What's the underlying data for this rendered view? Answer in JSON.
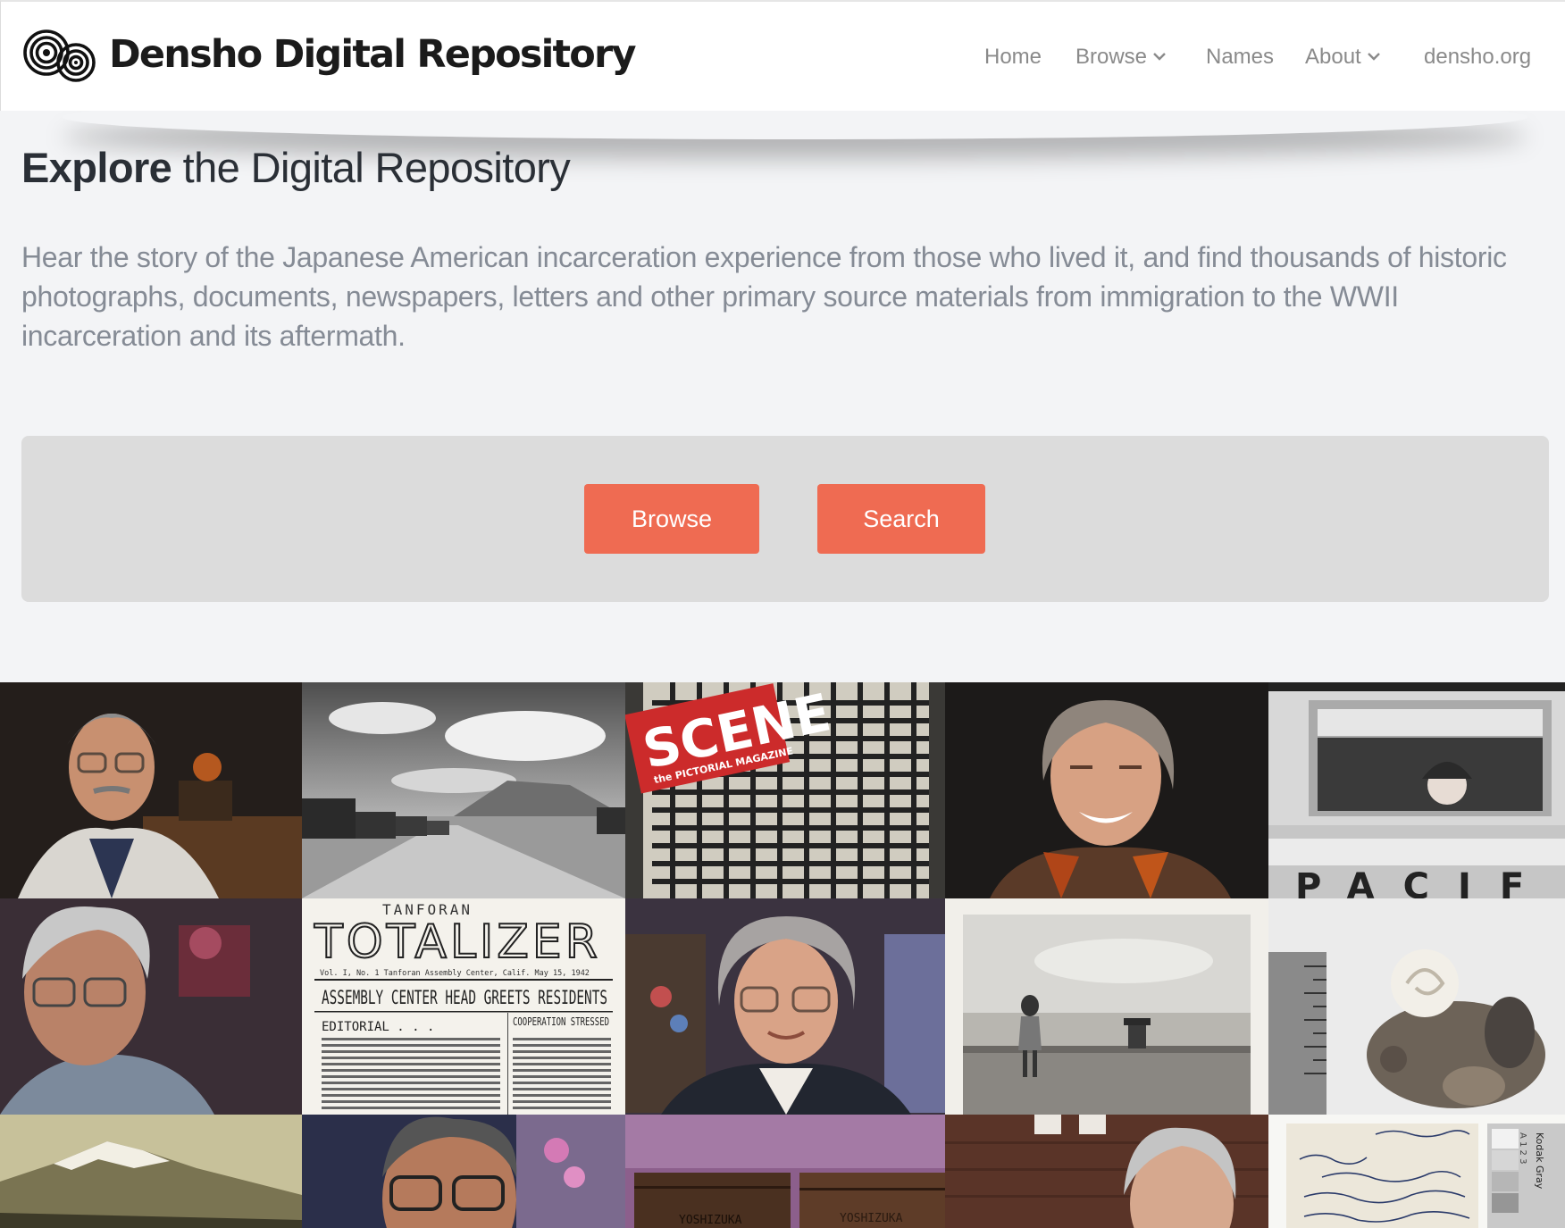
{
  "site": {
    "title": "Densho Digital Repository"
  },
  "nav": {
    "items": [
      {
        "label": "Home"
      },
      {
        "label": "Browse"
      },
      {
        "label": "Names"
      },
      {
        "label": "About"
      },
      {
        "label": "densho.org"
      }
    ]
  },
  "hero": {
    "title_bold": "Explore",
    "title_rest": "the Digital Repository",
    "intro": "Hear the story of the Japanese American incarceration experience from those who lived it, and find thousands of historic photographs, documents, newspapers, letters and other primary source materials from immigration to the WWII incarceration and its aftermath."
  },
  "actions": {
    "browse_label": "Browse",
    "search_label": "Search"
  },
  "mosaic": {
    "tiles": [
      {
        "name": "interview-man-1",
        "kind": "interview"
      },
      {
        "name": "camp-barracks-landscape",
        "kind": "photo-bw"
      },
      {
        "name": "scene-magazine-cover",
        "kind": "magazine",
        "text_1": "SCENE",
        "text_2": "the PICTORIAL MAGAZINE"
      },
      {
        "name": "interview-woman-1",
        "kind": "interview"
      },
      {
        "name": "child-at-bus-window",
        "kind": "photo-bw",
        "text": "PACIF"
      },
      {
        "name": "interview-man-2",
        "kind": "interview"
      },
      {
        "name": "tanforan-totalizer-newspaper",
        "kind": "newspaper",
        "masthead_top": "TANFORAN",
        "masthead": "TOTALIZER",
        "headline": "ASSEMBLY CENTER HEAD GREETS RESIDENTS",
        "col_1": "EDITORIAL . . .",
        "col_2": "COOPERATION STRESSED",
        "issue_line": "Vol. I, No. 1    Tanforan Assembly Center, Calif.    May 15, 1942"
      },
      {
        "name": "interview-woman-2",
        "kind": "interview"
      },
      {
        "name": "girl-in-field-photo",
        "kind": "photo-bw"
      },
      {
        "name": "shell-artifact-photo",
        "kind": "photo-bw"
      },
      {
        "name": "mountain-photo",
        "kind": "photo-sepia"
      },
      {
        "name": "interview-man-3",
        "kind": "interview"
      },
      {
        "name": "wooden-crate-photo",
        "kind": "photo",
        "text_1": "YOSHIZUKA",
        "text_2": "YOSHIZUKA"
      },
      {
        "name": "interview-woman-3",
        "kind": "interview"
      },
      {
        "name": "handwritten-letter",
        "kind": "document",
        "text_1": "Kodak Gray",
        "text_2": "A 1 2 3"
      }
    ]
  },
  "colors": {
    "accent": "#ef6b52",
    "panel": "#dcdcdc",
    "page_bg": "#f3f4f6",
    "nav_text": "#8a8a8a"
  }
}
